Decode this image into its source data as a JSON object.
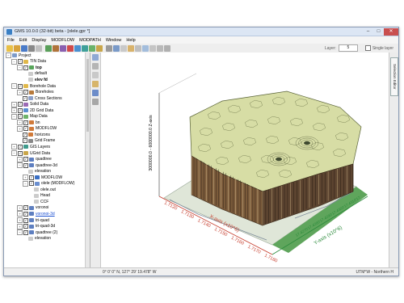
{
  "window": {
    "title": "GMS 10.0.0 (32-bit) beta - [olele.gpr *]",
    "controls": {
      "minimize": "–",
      "maximize": "□",
      "close": "✕"
    }
  },
  "menubar": [
    "File",
    "Edit",
    "Display",
    "MODFLOW",
    "MODPATH",
    "Window",
    "Help"
  ],
  "toolbar": {
    "layer_label": "Layer:",
    "layer_value": "5",
    "single_layer_label": "Single layer"
  },
  "tree": [
    {
      "label": "Project",
      "level": 0,
      "expander": "−",
      "icon": "project-icon",
      "icon_color": "#7d9bc9",
      "check": false
    },
    {
      "label": "TIN Data",
      "level": 1,
      "expander": "−",
      "icon": "tin-icon",
      "icon_color": "#e0b84a",
      "check": true
    },
    {
      "label": "top",
      "level": 2,
      "expander": "−",
      "icon": "tin-surface-icon",
      "icon_color": "#58a65b",
      "check": true,
      "bold": true
    },
    {
      "label": "default",
      "level": 3,
      "expander": "",
      "icon": "dataset-icon",
      "icon_color": "#cccccc",
      "check": false
    },
    {
      "label": "elev fd",
      "level": 3,
      "expander": "",
      "icon": "dataset-icon",
      "icon_color": "#cccccc",
      "check": false,
      "bold": true
    },
    {
      "label": "Borehole Data",
      "level": 1,
      "expander": "−",
      "icon": "folder-icon",
      "icon_color": "#e0b84a",
      "check": true
    },
    {
      "label": "Boreholes",
      "level": 2,
      "expander": "+",
      "icon": "borehole-icon",
      "icon_color": "#b77a3d",
      "check": true
    },
    {
      "label": "Cross Sections",
      "level": 2,
      "expander": "",
      "icon": "cross-section-icon",
      "icon_color": "#8da0c8",
      "check": true
    },
    {
      "label": "Solid Data",
      "level": 1,
      "expander": "+",
      "icon": "solid-icon",
      "icon_color": "#9b6bb5",
      "check": true
    },
    {
      "label": "2D Grid Data",
      "level": 1,
      "expander": "+",
      "icon": "grid2d-icon",
      "icon_color": "#5a8fd1",
      "check": true
    },
    {
      "label": "Map Data",
      "level": 1,
      "expander": "−",
      "icon": "map-icon",
      "icon_color": "#6db36a",
      "check": true
    },
    {
      "label": "bn",
      "level": 2,
      "expander": "+",
      "icon": "coverage-icon",
      "icon_color": "#d07a3a",
      "check": true
    },
    {
      "label": "MODFLOW",
      "level": 2,
      "expander": "+",
      "icon": "coverage-icon",
      "icon_color": "#d07a3a",
      "check": true
    },
    {
      "label": "horizons",
      "level": 2,
      "expander": "",
      "icon": "coverage-icon",
      "icon_color": "#d07a3a",
      "check": true
    },
    {
      "label": "Grid Frame",
      "level": 2,
      "expander": "",
      "icon": "grid-frame-icon",
      "icon_color": "#888888",
      "check": true
    },
    {
      "label": "GIS Layers",
      "level": 1,
      "expander": "+",
      "icon": "gis-icon",
      "icon_color": "#3f9a8c",
      "check": true
    },
    {
      "label": "UGrid Data",
      "level": 1,
      "expander": "−",
      "icon": "ugrid-icon",
      "icon_color": "#c9a64a",
      "check": true
    },
    {
      "label": "quadtree",
      "level": 2,
      "expander": "+",
      "icon": "ugrid-icon",
      "icon_color": "#5e7fc0",
      "check": true
    },
    {
      "label": "quadtree-3d",
      "level": 2,
      "expander": "−",
      "icon": "ugrid-icon",
      "icon_color": "#5e7fc0",
      "check": true
    },
    {
      "label": "elevation",
      "level": 3,
      "expander": "",
      "icon": "dataset-icon",
      "icon_color": "#cccccc",
      "check": false
    },
    {
      "label": "MODFLOW",
      "level": 3,
      "expander": "+",
      "icon": "modflow-icon",
      "icon_color": "#3a6fc4",
      "check": true
    },
    {
      "label": "olele (MODFLOW)",
      "level": 3,
      "expander": "−",
      "icon": "solution-icon",
      "icon_color": "#6b8fd0",
      "check": true
    },
    {
      "label": "olele.out",
      "level": 4,
      "expander": "",
      "icon": "file-icon",
      "icon_color": "#cccccc",
      "check": false
    },
    {
      "label": "Head",
      "level": 4,
      "expander": "",
      "icon": "dataset-icon",
      "icon_color": "#cccccc",
      "check": false
    },
    {
      "label": "CCF",
      "level": 4,
      "expander": "",
      "icon": "dataset-icon",
      "icon_color": "#cccccc",
      "check": false
    },
    {
      "label": "voronoi",
      "level": 2,
      "expander": "+",
      "icon": "ugrid-icon",
      "icon_color": "#5e7fc0",
      "check": true
    },
    {
      "label": "voronoi-3d",
      "level": 2,
      "expander": "+",
      "icon": "ugrid-icon",
      "icon_color": "#5e7fc0",
      "check": true,
      "link": true
    },
    {
      "label": "tri-quad",
      "level": 2,
      "expander": "+",
      "icon": "ugrid-icon",
      "icon_color": "#5e7fc0",
      "check": true
    },
    {
      "label": "tri-quad-3d",
      "level": 2,
      "expander": "+",
      "icon": "ugrid-icon",
      "icon_color": "#5e7fc0",
      "check": true
    },
    {
      "label": "quadtree (2)",
      "level": 2,
      "expander": "−",
      "icon": "ugrid-icon",
      "icon_color": "#5e7fc0",
      "check": true
    },
    {
      "label": "elevation",
      "level": 3,
      "expander": "",
      "icon": "dataset-icon",
      "icon_color": "#cccccc",
      "check": false
    }
  ],
  "view": {
    "z_axis_label": "3000000.0 - 6000000.0 Z-axis",
    "x_axis_label": "X-axis (x10^6)",
    "y_axis_label": "Y-axis (x10^6)",
    "x_ticks": [
      "1.7120",
      "1.7130",
      "1.7140",
      "1.7150",
      "1.7160",
      "1.7170",
      "1.7180"
    ],
    "y_ticks_label": "17.4270'17.4280'17.4290'17.4300'17.4310'17"
  },
  "side_tab": "Selection Editor",
  "statusbar": {
    "coords": "0° 0' 0\" N, 127° 29' 19.478\" W",
    "projection": "UTM°W - Northern H"
  }
}
